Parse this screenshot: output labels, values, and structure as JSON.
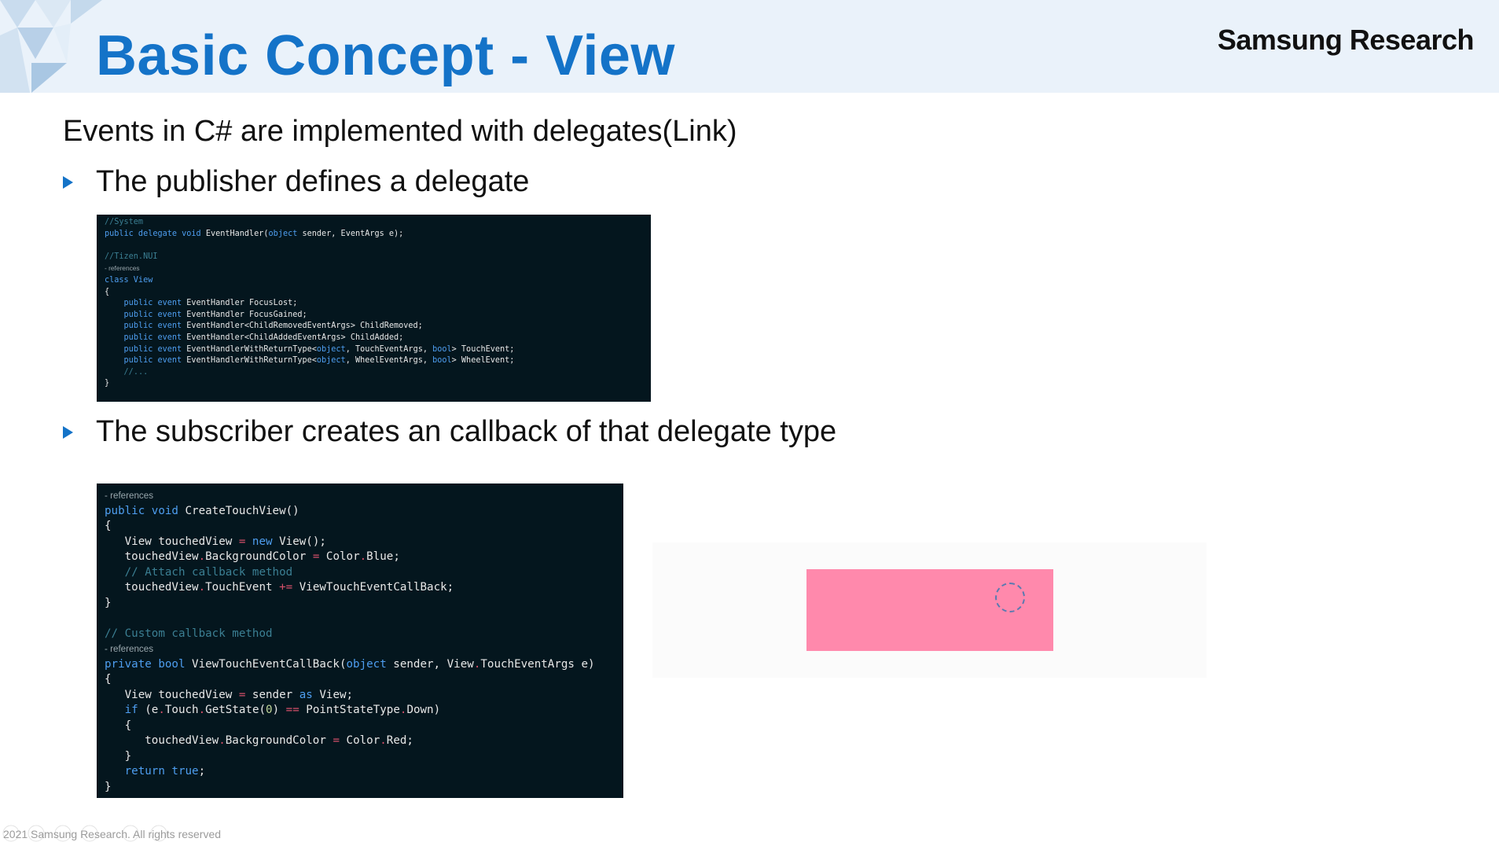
{
  "header": {
    "title": "Basic Concept - View",
    "brand": "Samsung Research"
  },
  "content": {
    "intro": "Events in C# are implemented with delegates(Link)",
    "bullet1": "The publisher defines a delegate",
    "bullet2": "The subscriber creates an callback of that delegate type"
  },
  "code_publisher": {
    "l1": "//System",
    "l2_a": "public delegate void ",
    "l2_b": "EventHandler(",
    "l2_c": "object",
    "l2_d": " sender, EventArgs e);",
    "l4": "//Tizen.NUI",
    "l5": "- references",
    "l6": "class View",
    "l7": "{",
    "e1_kw": "public event ",
    "e1": "EventHandler FocusLost;",
    "e2": "EventHandler FocusGained;",
    "e3": "EventHandler<ChildRemovedEventArgs> ChildRemoved;",
    "e4": "EventHandler<ChildAddedEventArgs> ChildAdded;",
    "e5_a": "EventHandlerWithReturnType<",
    "e5_b": "object",
    "e5_c": ", TouchEventArgs, ",
    "e5_d": "bool",
    "e5_e": "> TouchEvent;",
    "e6_a": "EventHandlerWithReturnType<",
    "e6_b": "object",
    "e6_c": ", WheelEventArgs, ",
    "e6_d": "bool",
    "e6_e": "> WheelEvent;",
    "l14": "//...",
    "l15": "}"
  },
  "code_subscriber": {
    "ref1": "- references",
    "m1_kw": "public void ",
    "m1": "CreateTouchView()",
    "open": "{",
    "close": "}",
    "s1_a": "View touchedView ",
    "s1_op": "=",
    "s1_kw": " new ",
    "s1_b": "View();",
    "s2_a": "touchedView",
    "s2_dot": ".",
    "s2_b": "BackgroundColor ",
    "s2_op": "=",
    "s2_c": " Color",
    "s2_d": "Blue;",
    "s3": "// Attach callback method",
    "s4_a": "touchedView",
    "s4_b": "TouchEvent ",
    "s4_op": "+=",
    "s4_c": " ViewTouchEventCallBack;",
    "c1": "// Custom callback method",
    "ref2": "- references",
    "m2_kw": "private bool ",
    "m2_a": "ViewTouchEventCallBack(",
    "m2_kw2": "object",
    "m2_b": " sender, View",
    "m2_c": "TouchEventArgs e)",
    "t1_a": "View touchedView ",
    "t1_op": "=",
    "t1_b": " sender ",
    "t1_kw": "as",
    "t1_c": " View;",
    "t2_kw": "if",
    "t2_a": " (e",
    "t2_b": "Touch",
    "t2_c": "GetState(",
    "t2_num": "0",
    "t2_d": ") ",
    "t2_op": "==",
    "t2_e": " PointStateType",
    "t2_f": "Down)",
    "t3_a": "touchedView",
    "t3_b": "BackgroundColor ",
    "t3_op": "=",
    "t3_c": " Color",
    "t3_d": "Red;",
    "r_kw": "return ",
    "r_val": "true",
    "r_end": ";"
  },
  "footer": {
    "copyright": "2021 Samsung Research. All rights reserved"
  },
  "colors": {
    "title": "#1473c8",
    "code_bg": "#04161e",
    "touch_view": "#ff89ac"
  }
}
